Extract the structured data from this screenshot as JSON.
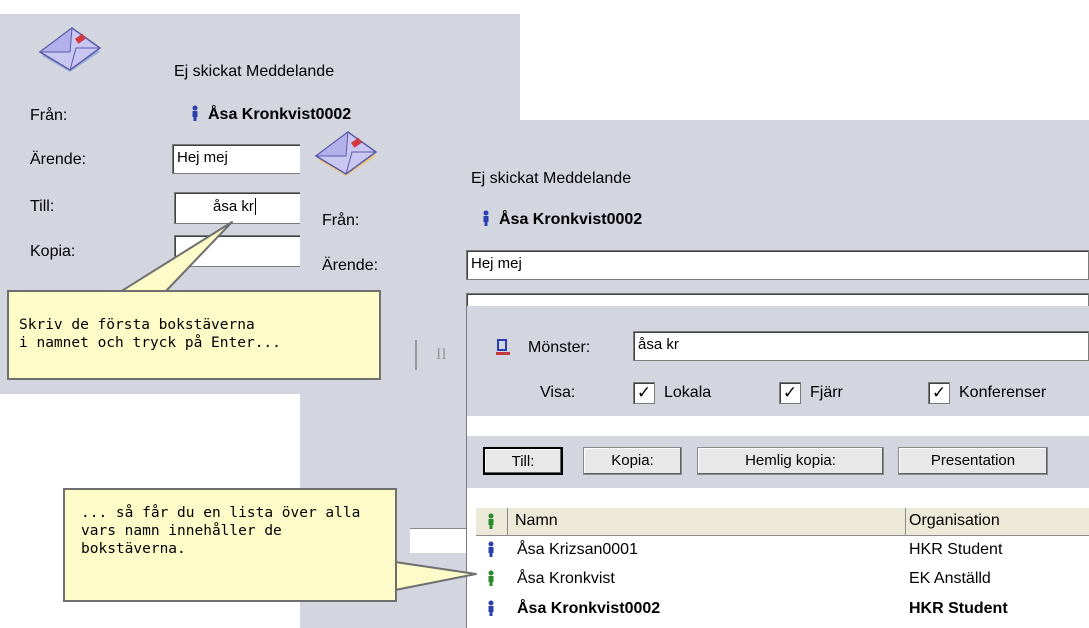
{
  "back_window": {
    "status": "Ej skickat Meddelande",
    "from_label": "Från:",
    "from_value": "Åsa Kronkvist0002",
    "subject_label": "Ärende:",
    "subject_value": "Hej mej",
    "to_label": "Till:",
    "to_value": "åsa kr",
    "cc_label": "Kopia:"
  },
  "front_window": {
    "status": "Ej skickat Meddelande",
    "from_label": "Från:",
    "from_value": "Åsa Kronkvist0002",
    "subject_label": "Ärende:",
    "subject_value": "Hej mej"
  },
  "search_panel": {
    "pattern_label": "Mönster:",
    "pattern_value": "åsa kr",
    "show_label": "Visa:",
    "checkboxes": [
      {
        "label": "Lokala",
        "checked": true
      },
      {
        "label": "Fjärr",
        "checked": true
      },
      {
        "label": "Konferenser",
        "checked": true
      }
    ],
    "buttons": {
      "to": "Till:",
      "cc": "Kopia:",
      "bcc": "Hemlig kopia:",
      "presentation": "Presentation"
    },
    "columns": {
      "name": "Namn",
      "org": "Organisation"
    },
    "rows": [
      {
        "name": "Åsa Krizsan0001",
        "org": "HKR Student",
        "bold": false,
        "icon": "person-blue-icon"
      },
      {
        "name": "Åsa Kronkvist",
        "org": "EK Anställd",
        "bold": false,
        "icon": "person-green-icon"
      },
      {
        "name": "Åsa Kronkvist0002",
        "org": "HKR Student",
        "bold": true,
        "icon": "person-blue-icon"
      }
    ]
  },
  "callouts": {
    "first": "Skriv de första bokstäverna\ni namnet och tryck på Enter...",
    "second": "... så får du en lista över alla\nvars namn innehåller de\nbokstäverna."
  },
  "toolbar_fragment": "II",
  "colors": {
    "window_bg": "#d3d6df",
    "panel_bg": "#ffffff",
    "callout_bg": "#fdfcc8",
    "person_blue": "#2b3fae",
    "person_green": "#2a8a2a"
  }
}
